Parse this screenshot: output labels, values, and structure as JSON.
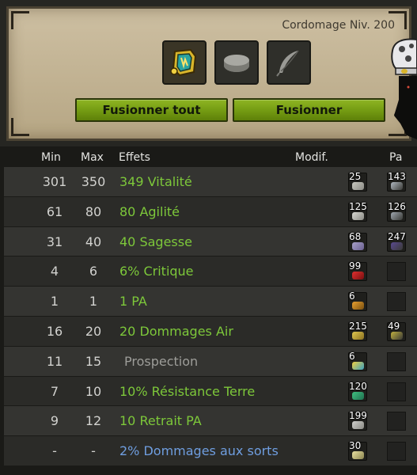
{
  "header": {
    "profession": "Cordomage Niv. 200"
  },
  "buttons": {
    "merge_all": "Fusionner tout",
    "merge": "Fusionner"
  },
  "slots": [
    {
      "icon": "item-boots-icon"
    },
    {
      "icon": "rune-stone-icon"
    },
    {
      "icon": "feather-icon"
    }
  ],
  "table": {
    "headers": {
      "min": "Min",
      "max": "Max",
      "effects": "Effets",
      "modif": "Modif.",
      "pa": "Pa"
    },
    "rows": [
      {
        "min": "301",
        "max": "350",
        "effect": "349 Vitalité",
        "color": "green",
        "rune1": "25",
        "rune2": "143"
      },
      {
        "min": "61",
        "max": "80",
        "effect": "80 Agilité",
        "color": "green",
        "rune1": "125",
        "rune2": "126"
      },
      {
        "min": "31",
        "max": "40",
        "effect": "40 Sagesse",
        "color": "green",
        "rune1": "68",
        "rune2": "247"
      },
      {
        "min": "4",
        "max": "6",
        "effect": "6% Critique",
        "color": "green",
        "rune1": "99",
        "rune2": ""
      },
      {
        "min": "1",
        "max": "1",
        "effect": "1 PA",
        "color": "green",
        "rune1": "6",
        "rune2": ""
      },
      {
        "min": "16",
        "max": "20",
        "effect": "20 Dommages Air",
        "color": "green",
        "rune1": "215",
        "rune2": "49"
      },
      {
        "min": "11",
        "max": "15",
        "effect": "Prospection",
        "color": "grey",
        "rune1": "6",
        "rune2": ""
      },
      {
        "min": "7",
        "max": "10",
        "effect": "10% Résistance Terre",
        "color": "green",
        "rune1": "120",
        "rune2": ""
      },
      {
        "min": "9",
        "max": "12",
        "effect": "10 Retrait PA",
        "color": "green",
        "rune1": "199",
        "rune2": ""
      },
      {
        "min": "-",
        "max": "-",
        "effect": "2% Dommages aux sorts",
        "color": "blue",
        "rune1": "30",
        "rune2": ""
      }
    ]
  },
  "colors": {
    "effect_green": "#7dc83a",
    "effect_grey": "#9d9d99",
    "effect_blue": "#6f9ee0",
    "button_green": "#7ca317"
  }
}
